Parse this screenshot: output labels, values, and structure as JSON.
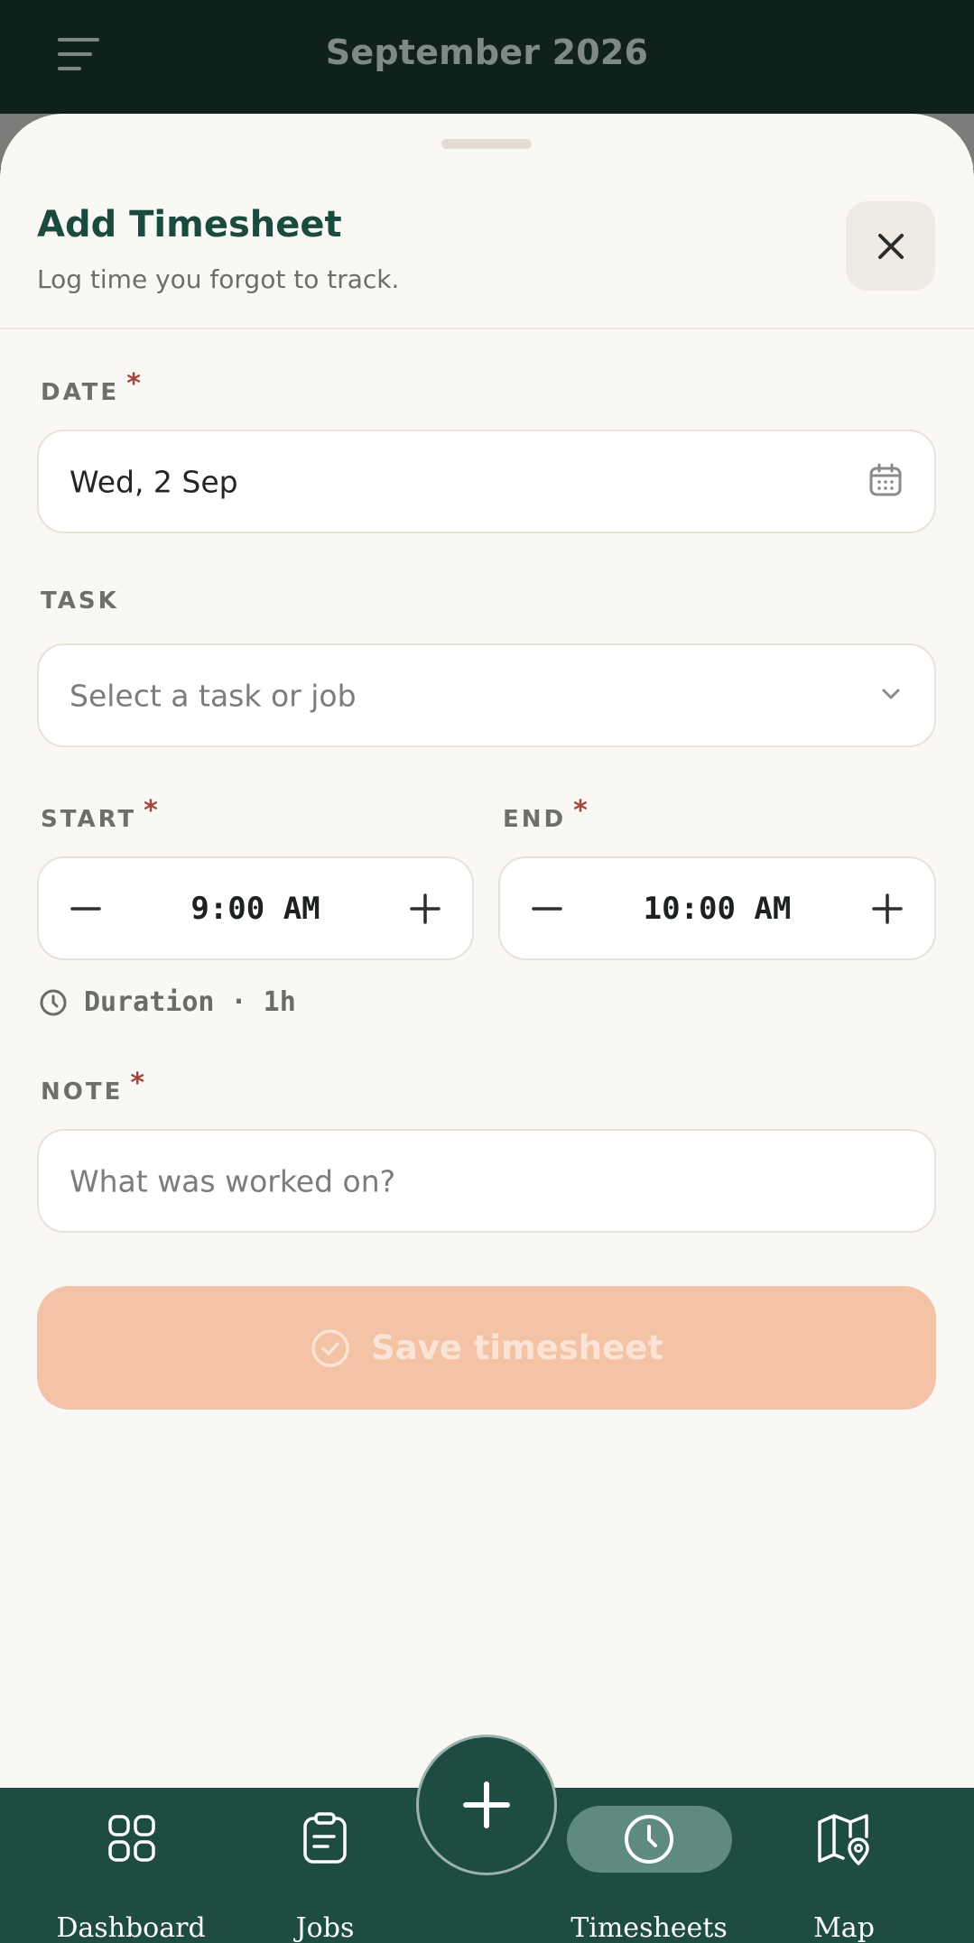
{
  "header": {
    "title": "September 2026",
    "menu_icon": "hamburger-icon"
  },
  "sheet": {
    "title": "Add Timesheet",
    "subtitle": "Log time you forgot to track.",
    "close_icon": "close-icon"
  },
  "form": {
    "date": {
      "label": "DATE",
      "required": "*",
      "value": "Wed, 2 Sep",
      "icon": "calendar-icon"
    },
    "task": {
      "label": "TASK",
      "placeholder": "Select a task or job",
      "icon": "chevron-down-icon"
    },
    "start": {
      "label": "START",
      "required": "*",
      "value": "9:00 AM"
    },
    "end": {
      "label": "END",
      "required": "*",
      "value": "10:00 AM"
    },
    "duration": "Duration · 1h",
    "note": {
      "label": "NOTE",
      "required": "*",
      "placeholder": "What was worked on?"
    }
  },
  "save_button": {
    "label": "Save timesheet",
    "icon": "check-circle-icon"
  },
  "nav": {
    "items": [
      {
        "label": "Dashboard",
        "icon": "grid-icon"
      },
      {
        "label": "Jobs",
        "icon": "clipboard-icon"
      },
      {
        "label": "Timesheets",
        "icon": "clock-icon",
        "active": true
      },
      {
        "label": "Map",
        "icon": "map-pin-icon"
      }
    ],
    "fab_icon": "plus-icon"
  },
  "colors": {
    "primary": "#1e4b42",
    "accent_disabled": "#f4c2a4",
    "required": "#a4453b",
    "sheet_bg": "#faf8f5"
  }
}
